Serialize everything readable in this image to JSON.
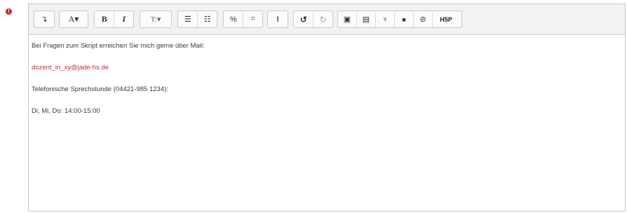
{
  "required_marker": "!",
  "toolbar": {
    "groups": [
      {
        "buttons": [
          {
            "icon": "collapse-icon",
            "glyph": "↴"
          }
        ]
      },
      {
        "buttons": [
          {
            "icon": "font-color-icon",
            "glyph": "A▾"
          }
        ]
      },
      {
        "buttons": [
          {
            "icon": "bold-icon",
            "glyph": "B"
          },
          {
            "icon": "italic-icon",
            "glyph": "I"
          }
        ]
      },
      {
        "buttons": [
          {
            "icon": "paragraph-style-icon",
            "glyph": "T:▾"
          }
        ]
      },
      {
        "buttons": [
          {
            "icon": "unordered-list-icon",
            "glyph": "☰"
          },
          {
            "icon": "ordered-list-icon",
            "glyph": "☷"
          }
        ]
      },
      {
        "buttons": [
          {
            "icon": "link-icon",
            "glyph": "%"
          },
          {
            "icon": "unlink-icon",
            "glyph": "⌗"
          }
        ]
      },
      {
        "buttons": [
          {
            "icon": "emoticon-icon",
            "glyph": "!"
          }
        ]
      },
      {
        "buttons": [
          {
            "icon": "undo-icon",
            "glyph": "↺"
          },
          {
            "icon": "redo-icon",
            "glyph": "↻"
          }
        ]
      },
      {
        "buttons": [
          {
            "icon": "image-icon",
            "glyph": "▣"
          },
          {
            "icon": "media-icon",
            "glyph": "▤"
          },
          {
            "icon": "record-audio-icon",
            "glyph": "♆"
          },
          {
            "icon": "record-video-icon",
            "glyph": "■"
          },
          {
            "icon": "manage-files-icon",
            "glyph": "⊘"
          },
          {
            "icon": "h5p-icon",
            "glyph": "H5P"
          }
        ]
      }
    ]
  },
  "content": {
    "lines": [
      {
        "text": "Bei Fragen zum Skript erreichen Sie mich gerne über Mail:",
        "style": "text"
      },
      {
        "text": "dozent_in_xy@jade-hs.de",
        "style": "link"
      },
      {
        "text": "Telefonische Sprechstunde (04421-985 1234):",
        "style": "text"
      },
      {
        "text": "Di, Mi, Do: 14:00-15:00",
        "style": "text"
      }
    ]
  },
  "colors": {
    "link": "#c8283c",
    "required": "#c9262d",
    "toolbar_bg": "#f2f2f2"
  }
}
